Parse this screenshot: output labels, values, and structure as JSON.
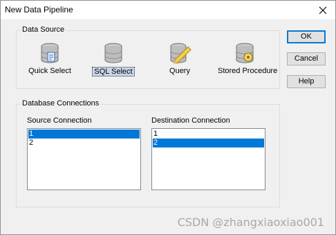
{
  "window": {
    "title": "New Data Pipeline"
  },
  "data_source": {
    "label": "Data Source",
    "items": [
      {
        "label": "Quick Select",
        "icon": "database-form-icon",
        "selected": false
      },
      {
        "label": "SQL Select",
        "icon": "database-icon",
        "selected": true
      },
      {
        "label": "Query",
        "icon": "query-pencil-icon",
        "selected": false
      },
      {
        "label": "Stored Procedure",
        "icon": "stored-procedure-icon",
        "selected": false
      }
    ]
  },
  "buttons": {
    "ok": "OK",
    "cancel": "Cancel",
    "help": "Help"
  },
  "connections": {
    "label": "Database Connections",
    "source": {
      "label": "Source Connection",
      "rows": [
        "1",
        "2"
      ],
      "selected_index": 0
    },
    "destination": {
      "label": "Destination Connection",
      "rows": [
        "1",
        "2"
      ],
      "selected_index": 1
    }
  },
  "watermark": "CSDN @zhangxiaoxiao001",
  "colors": {
    "selection": "#0078d7",
    "default_button_border": "#0078d7"
  }
}
